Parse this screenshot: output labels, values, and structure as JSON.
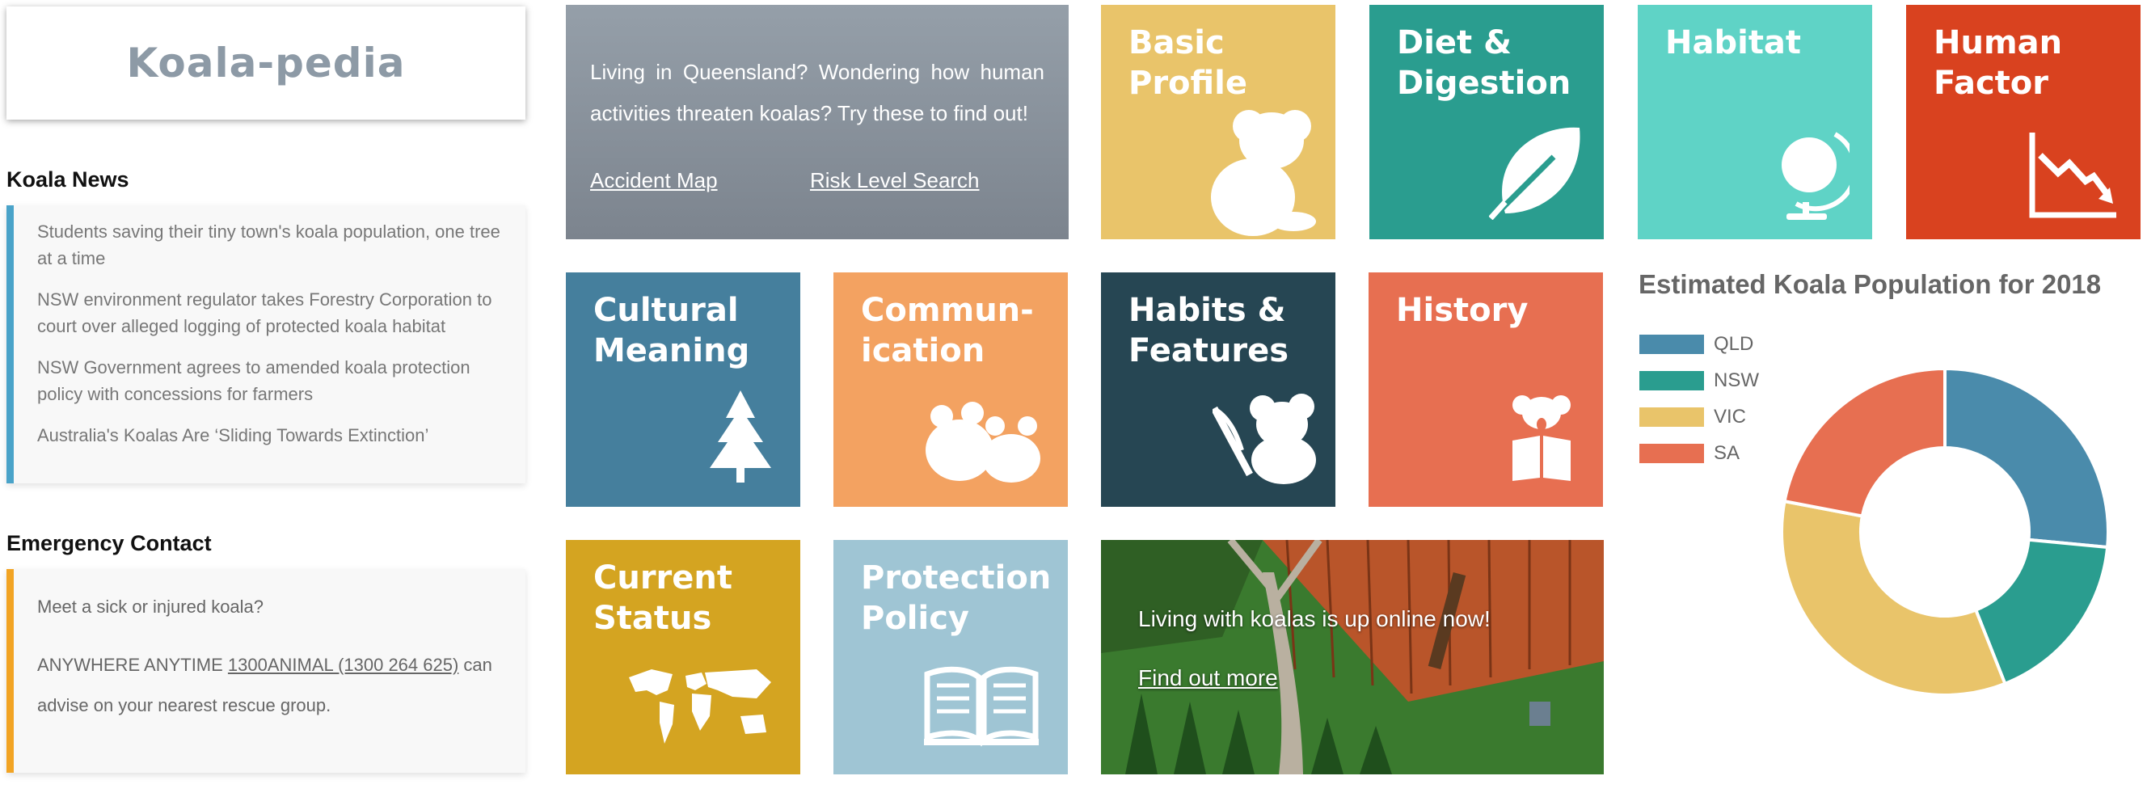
{
  "logo": {
    "text": "Koala-pedia"
  },
  "news": {
    "title": "Koala News",
    "items": [
      "Students saving their tiny town's koala population, one tree at a time",
      "NSW environment regulator takes Forestry Corporation to court over alleged logging of protected koala habitat",
      "NSW Government agrees to amended koala protection policy with concessions for farmers",
      "Australia's Koalas Are ‘Sliding Towards Extinction’"
    ]
  },
  "emergency": {
    "title": "Emergency Contact",
    "line1": "Meet a sick or injured koala?",
    "line2_prefix": "ANYWHERE ANYTIME ",
    "line2_link": "1300ANIMAL (1300 264 625)",
    "line2_suffix": " can",
    "line3": "advise on your nearest rescue group."
  },
  "promo": {
    "text": "Living in Queensland? Wondering how human activities threaten koalas? Try these to find out!",
    "link1": "Accident Map",
    "link2": "Risk Level Search"
  },
  "tiles": {
    "basic_profile": {
      "label": "Basic\nProfile",
      "color": "#e9c46a",
      "icon": "koala-sitting-icon"
    },
    "diet": {
      "label": "Diet &\nDigestion",
      "color": "#2a9d8f",
      "icon": "leaf-icon"
    },
    "habitat": {
      "label": "Habitat",
      "color": "#5fd3c6",
      "icon": "globe-icon"
    },
    "human_factor": {
      "label": "Human\nFactor",
      "color": "#d9421f",
      "icon": "chart-down-icon"
    },
    "cultural": {
      "label": "Cultural\nMeaning",
      "color": "#457f9d",
      "icon": "tree-icon"
    },
    "communication": {
      "label": "Commun-\nication",
      "color": "#f3a261",
      "icon": "koalas-icon"
    },
    "habits": {
      "label": "Habits &\nFeatures",
      "color": "#264653",
      "icon": "koala-eating-icon"
    },
    "history": {
      "label": "History",
      "color": "#e76f51",
      "icon": "koala-reading-icon"
    },
    "current_status": {
      "label": "Current\nStatus",
      "color": "#d4a421",
      "icon": "world-map-icon"
    },
    "protection": {
      "label": "Protection\nPolicy",
      "color": "#9fc5d4",
      "icon": "book-icon"
    }
  },
  "banner": {
    "text": "Living with koalas is up online now!",
    "link": "Find out more"
  },
  "chart_data": {
    "type": "pie",
    "title": "Estimated Koala Population for 2018",
    "series": [
      {
        "name": "QLD",
        "value": 26.5,
        "color": "#4a8bab"
      },
      {
        "name": "NSW",
        "value": 17.5,
        "color": "#2a9d8f"
      },
      {
        "name": "VIC",
        "value": 34,
        "color": "#e9c46a"
      },
      {
        "name": "SA",
        "value": 22,
        "color": "#e76f51"
      }
    ],
    "donut": true,
    "legend": "top-left"
  }
}
